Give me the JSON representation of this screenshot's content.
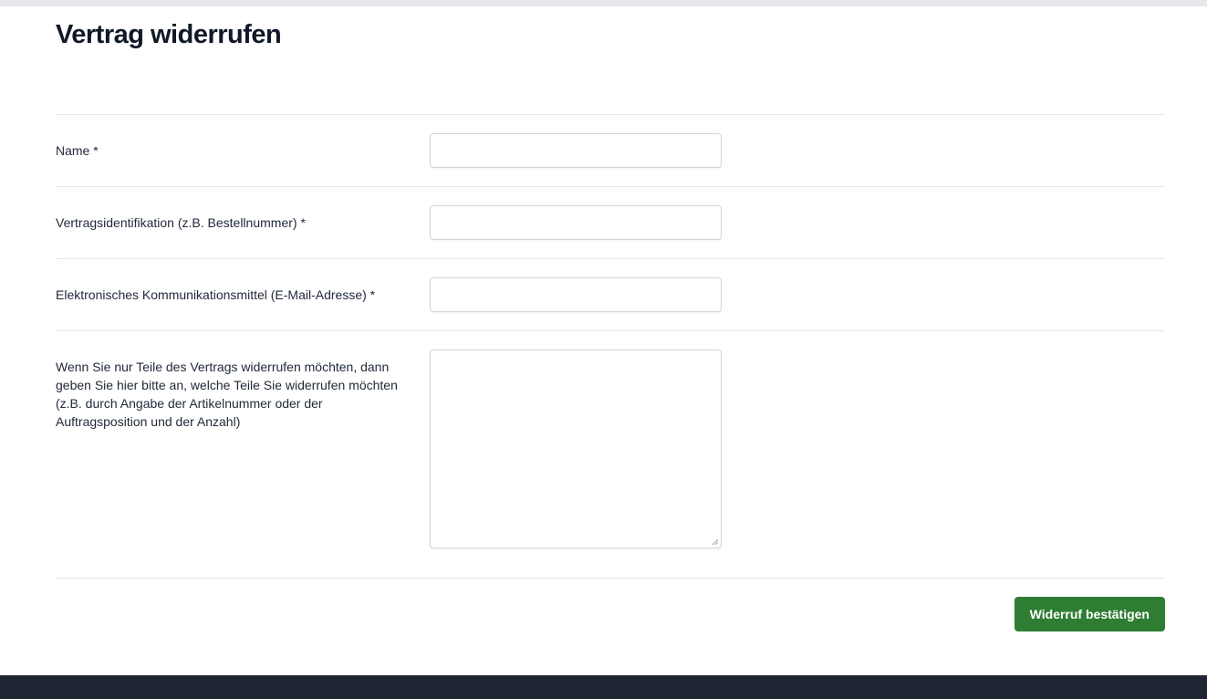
{
  "page": {
    "title": "Vertrag widerrufen"
  },
  "form": {
    "fields": [
      {
        "label": "Name *",
        "value": "",
        "placeholder": ""
      },
      {
        "label": "Vertragsidentifikation (z.B. Bestellnummer) *",
        "value": "",
        "placeholder": ""
      },
      {
        "label": "Elektronisches Kommunikationsmittel (E-Mail-Adresse) *",
        "value": "",
        "placeholder": ""
      },
      {
        "label": "Wenn Sie nur Teile des Vertrags widerrufen möchten, dann geben Sie hier bitte an, welche Teile Sie widerrufen möchten (z.B. durch Angabe der Artikelnummer oder der Auftragsposition und der Anzahl)",
        "value": "",
        "placeholder": ""
      }
    ],
    "submit_label": "Widerruf bestätigen"
  },
  "colors": {
    "submit_button": "#2e7d32",
    "footer": "#1f2533",
    "top_bar": "#e5e7eb"
  }
}
